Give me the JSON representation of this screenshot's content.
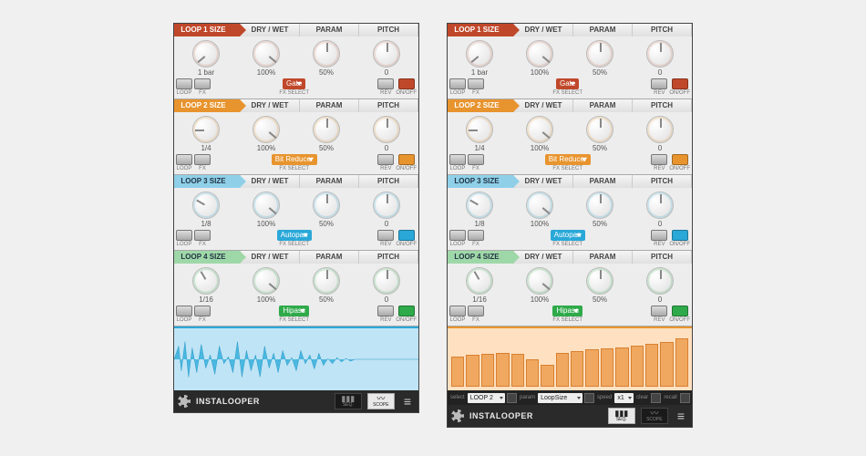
{
  "brand": "INSTALOOPER",
  "footer_tabs": {
    "seq": "SEQ.",
    "scope": "SCOPE"
  },
  "strip_headers": [
    "DRY / WET",
    "PARAM",
    "PITCH"
  ],
  "control_labels": {
    "loop": "LOOP",
    "fx": "FX",
    "fxselect": "FX SELECT",
    "rev": "REV",
    "onoff": "ON/OFF"
  },
  "loops": [
    {
      "title": "LOOP 1 SIZE",
      "size": "1 bar",
      "dry": "100%",
      "param": "50%",
      "pitch": "0",
      "fx": "Gate"
    },
    {
      "title": "LOOP 2 SIZE",
      "size": "1/4",
      "dry": "100%",
      "param": "50%",
      "pitch": "0",
      "fx": "Bit Reducer"
    },
    {
      "title": "LOOP 3 SIZE",
      "size": "1/8",
      "dry": "100%",
      "param": "50%",
      "pitch": "0",
      "fx": "Autopan"
    },
    {
      "title": "LOOP 4 SIZE",
      "size": "1/16",
      "dry": "100%",
      "param": "50%",
      "pitch": "0",
      "fx": "Hipass"
    }
  ],
  "seq_controls": {
    "select_label": "select",
    "select_value": "LOOP 2",
    "param_label": "param",
    "param_value": "LoopSize",
    "speed_label": "speed",
    "speed_value": "x1",
    "clear_label": "clear",
    "recall_label": "recall"
  },
  "seq_bars_pct": [
    55,
    58,
    60,
    62,
    60,
    50,
    40,
    62,
    65,
    68,
    70,
    72,
    75,
    78,
    82,
    88
  ],
  "active_tab": {
    "left": "scope",
    "right": "seq"
  }
}
